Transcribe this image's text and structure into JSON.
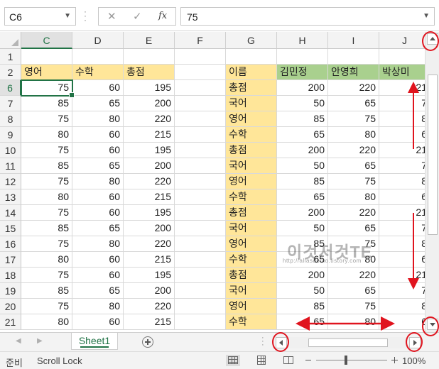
{
  "formula_bar": {
    "name_box": "C6",
    "cancel_icon": "✕",
    "confirm_icon": "✓",
    "fx_label": "fx",
    "value": "75"
  },
  "columns": [
    "C",
    "D",
    "E",
    "F",
    "G",
    "H",
    "I",
    "J"
  ],
  "selected_column": "C",
  "row_numbers": [
    "1",
    "2",
    "6",
    "7",
    "8",
    "9",
    "10",
    "11",
    "12",
    "13",
    "14",
    "15",
    "16",
    "17",
    "18",
    "19",
    "20",
    "21"
  ],
  "selected_row": "6",
  "left_table": {
    "headers": [
      "영어",
      "수학",
      "총점"
    ],
    "rows": [
      [
        "75",
        "60",
        "195"
      ],
      [
        "85",
        "65",
        "200"
      ],
      [
        "75",
        "80",
        "220"
      ],
      [
        "80",
        "60",
        "215"
      ],
      [
        "75",
        "60",
        "195"
      ],
      [
        "85",
        "65",
        "200"
      ],
      [
        "75",
        "80",
        "220"
      ],
      [
        "80",
        "60",
        "215"
      ],
      [
        "75",
        "60",
        "195"
      ],
      [
        "85",
        "65",
        "200"
      ],
      [
        "75",
        "80",
        "220"
      ],
      [
        "80",
        "60",
        "215"
      ],
      [
        "75",
        "60",
        "195"
      ],
      [
        "85",
        "65",
        "200"
      ],
      [
        "75",
        "80",
        "220"
      ],
      [
        "80",
        "60",
        "215"
      ]
    ]
  },
  "right_table": {
    "headers": [
      "이름",
      "김민정",
      "안영희",
      "박상미"
    ],
    "rows": [
      [
        "총점",
        "200",
        "220",
        "21"
      ],
      [
        "국어",
        "50",
        "65",
        "7"
      ],
      [
        "영어",
        "85",
        "75",
        "8"
      ],
      [
        "수학",
        "65",
        "80",
        "6"
      ],
      [
        "총점",
        "200",
        "220",
        "21"
      ],
      [
        "국어",
        "50",
        "65",
        "7"
      ],
      [
        "영어",
        "85",
        "75",
        "8"
      ],
      [
        "수학",
        "65",
        "80",
        "6"
      ],
      [
        "총점",
        "200",
        "220",
        "21"
      ],
      [
        "국어",
        "50",
        "65",
        "7"
      ],
      [
        "영어",
        "85",
        "75",
        "8"
      ],
      [
        "수학",
        "65",
        "80",
        "6"
      ],
      [
        "총점",
        "200",
        "220",
        "21"
      ],
      [
        "국어",
        "50",
        "65",
        "7"
      ],
      [
        "영어",
        "85",
        "75",
        "8"
      ],
      [
        "수학",
        "65",
        "80",
        "6"
      ]
    ]
  },
  "sheet_tabs": {
    "active": "Sheet1"
  },
  "status_bar": {
    "ready": "준비",
    "scroll_lock": "Scroll Lock",
    "zoom": "100%"
  },
  "watermark": {
    "text": "이것저것TE",
    "url": "http://allasdemo.tistory.com"
  },
  "colors": {
    "accent": "#217346",
    "header_yellow": "#ffe699",
    "header_green": "#a9d08e",
    "annotation_red": "#e0141e"
  }
}
